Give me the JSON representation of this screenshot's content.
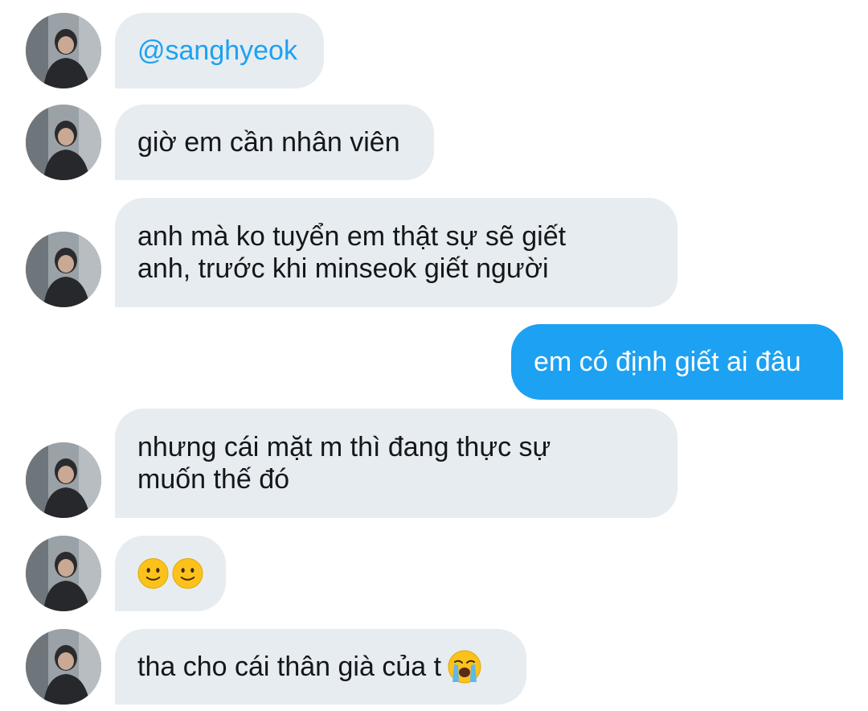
{
  "messages": [
    {
      "sender": "other",
      "text": "@sanghyeok",
      "style": "mention"
    },
    {
      "sender": "other",
      "text": "giờ em cần nhân viên"
    },
    {
      "sender": "other",
      "text": "anh mà ko tuyển em thật sự sẽ giết anh, trước khi minseok giết người"
    },
    {
      "sender": "me",
      "text": "em có định giết ai đâu"
    },
    {
      "sender": "other",
      "text": "nhưng cái mặt m thì đang thực sự muốn thế đó"
    },
    {
      "sender": "other",
      "emojis": [
        "slightly-smiling-face",
        "slightly-smiling-face"
      ]
    },
    {
      "sender": "other",
      "text": "tha cho cái thân già của t",
      "emoji": "loudly-crying-face"
    }
  ],
  "colors": {
    "incoming_bubble": "#e6ecf0",
    "outgoing_bubble": "#1da1f2",
    "mention": "#1da1f2",
    "text": "#14171a"
  }
}
